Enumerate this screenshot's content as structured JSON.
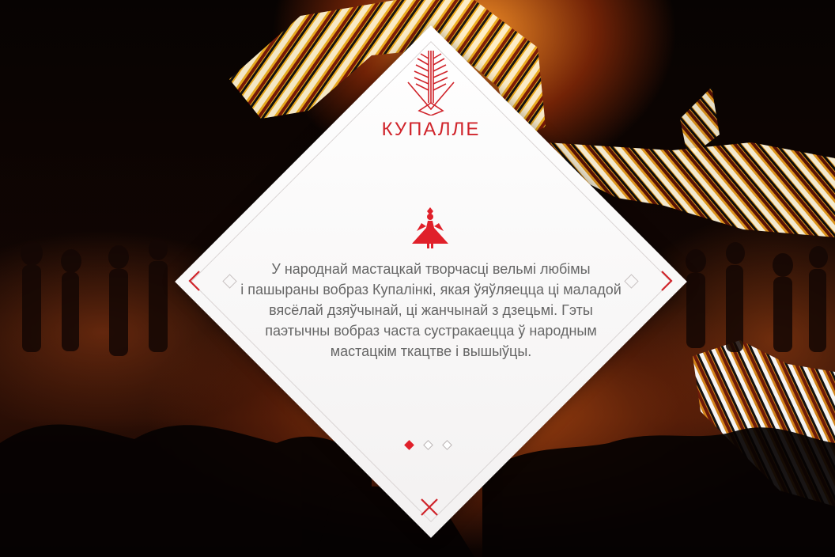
{
  "title": "КУПАЛЛЕ",
  "slide": {
    "text_lines": [
      "У народнай мастацкай творчасці вельмі любімы",
      "і пашыраны вобраз Купалінкі, якая ўяўляецца ці маладой",
      "вясёлай дзяўчынай, ці жанчынай з дзецьмі. Гэты",
      "паэтычны вобраз часта сустракаецца ў народным",
      "мастацкім ткацтве і вышыўцы."
    ]
  },
  "pagination": {
    "total": 3,
    "current": 1
  },
  "icons": {
    "logo": "tree-of-life-icon",
    "figure": "kupalinka-figure-icon",
    "prev": "chevron-left-icon",
    "next": "chevron-right-icon",
    "close": "close-icon"
  },
  "colors": {
    "accent": "#d0242b",
    "text": "#666666",
    "card": "#ffffff"
  }
}
